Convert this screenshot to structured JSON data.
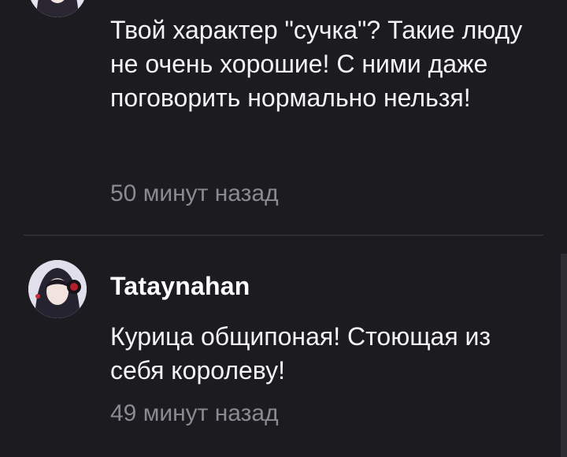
{
  "comments": [
    {
      "author": "",
      "text": "Твой характер \"сучка\"? Такие люду не очень хорошие! С ними даже поговорить нормально нельзя!",
      "time": "50 минут назад"
    },
    {
      "author": "Tataynahan",
      "text": "Курица общипоная! Стоющая из себя королеву!",
      "time": "49 минут назад"
    }
  ],
  "icons": {
    "avatar": "user-avatar-icon"
  },
  "colors": {
    "background": "#1c1b20",
    "text": "#f4f4f4",
    "timestamp": "#8b8a90",
    "divider": "#3a3940"
  }
}
